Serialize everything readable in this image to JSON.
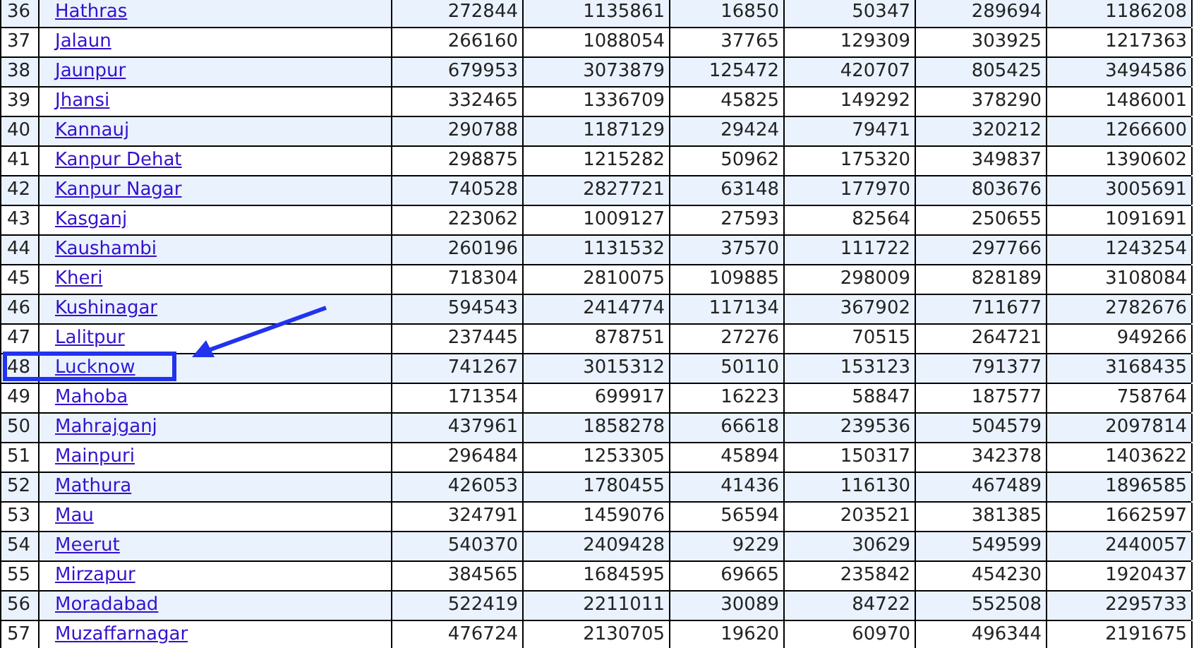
{
  "table": {
    "rows": [
      {
        "index": "36",
        "district": "Hathras",
        "highlighted": false,
        "values": [
          "272844",
          "1135861",
          "16850",
          "50347",
          "289694",
          "1186208"
        ]
      },
      {
        "index": "37",
        "district": "Jalaun",
        "highlighted": false,
        "values": [
          "266160",
          "1088054",
          "37765",
          "129309",
          "303925",
          "1217363"
        ]
      },
      {
        "index": "38",
        "district": "Jaunpur",
        "highlighted": false,
        "values": [
          "679953",
          "3073879",
          "125472",
          "420707",
          "805425",
          "3494586"
        ]
      },
      {
        "index": "39",
        "district": "Jhansi",
        "highlighted": false,
        "values": [
          "332465",
          "1336709",
          "45825",
          "149292",
          "378290",
          "1486001"
        ]
      },
      {
        "index": "40",
        "district": "Kannauj",
        "highlighted": false,
        "values": [
          "290788",
          "1187129",
          "29424",
          "79471",
          "320212",
          "1266600"
        ]
      },
      {
        "index": "41",
        "district": "Kanpur Dehat",
        "highlighted": false,
        "values": [
          "298875",
          "1215282",
          "50962",
          "175320",
          "349837",
          "1390602"
        ]
      },
      {
        "index": "42",
        "district": "Kanpur Nagar",
        "highlighted": false,
        "values": [
          "740528",
          "2827721",
          "63148",
          "177970",
          "803676",
          "3005691"
        ]
      },
      {
        "index": "43",
        "district": "Kasganj",
        "highlighted": false,
        "values": [
          "223062",
          "1009127",
          "27593",
          "82564",
          "250655",
          "1091691"
        ]
      },
      {
        "index": "44",
        "district": "Kaushambi",
        "highlighted": false,
        "values": [
          "260196",
          "1131532",
          "37570",
          "111722",
          "297766",
          "1243254"
        ]
      },
      {
        "index": "45",
        "district": "Kheri",
        "highlighted": false,
        "values": [
          "718304",
          "2810075",
          "109885",
          "298009",
          "828189",
          "3108084"
        ]
      },
      {
        "index": "46",
        "district": "Kushinagar",
        "highlighted": false,
        "values": [
          "594543",
          "2414774",
          "117134",
          "367902",
          "711677",
          "2782676"
        ]
      },
      {
        "index": "47",
        "district": "Lalitpur",
        "highlighted": false,
        "values": [
          "237445",
          "878751",
          "27276",
          "70515",
          "264721",
          "949266"
        ]
      },
      {
        "index": "48",
        "district": "Lucknow",
        "highlighted": true,
        "values": [
          "741267",
          "3015312",
          "50110",
          "153123",
          "791377",
          "3168435"
        ]
      },
      {
        "index": "49",
        "district": "Mahoba",
        "highlighted": false,
        "values": [
          "171354",
          "699917",
          "16223",
          "58847",
          "187577",
          "758764"
        ]
      },
      {
        "index": "50",
        "district": "Mahrajganj",
        "highlighted": false,
        "values": [
          "437961",
          "1858278",
          "66618",
          "239536",
          "504579",
          "2097814"
        ]
      },
      {
        "index": "51",
        "district": "Mainpuri",
        "highlighted": false,
        "values": [
          "296484",
          "1253305",
          "45894",
          "150317",
          "342378",
          "1403622"
        ]
      },
      {
        "index": "52",
        "district": "Mathura",
        "highlighted": false,
        "values": [
          "426053",
          "1780455",
          "41436",
          "116130",
          "467489",
          "1896585"
        ]
      },
      {
        "index": "53",
        "district": "Mau",
        "highlighted": false,
        "values": [
          "324791",
          "1459076",
          "56594",
          "203521",
          "381385",
          "1662597"
        ]
      },
      {
        "index": "54",
        "district": "Meerut",
        "highlighted": false,
        "values": [
          "540370",
          "2409428",
          "9229",
          "30629",
          "549599",
          "2440057"
        ]
      },
      {
        "index": "55",
        "district": "Mirzapur",
        "highlighted": false,
        "values": [
          "384565",
          "1684595",
          "69665",
          "235842",
          "454230",
          "1920437"
        ]
      },
      {
        "index": "56",
        "district": "Moradabad",
        "highlighted": false,
        "values": [
          "522419",
          "2211011",
          "30089",
          "84722",
          "552508",
          "2295733"
        ]
      },
      {
        "index": "57",
        "district": "Muzaffarnagar",
        "highlighted": false,
        "values": [
          "476724",
          "2130705",
          "19620",
          "60970",
          "496344",
          "2191675"
        ]
      }
    ]
  }
}
